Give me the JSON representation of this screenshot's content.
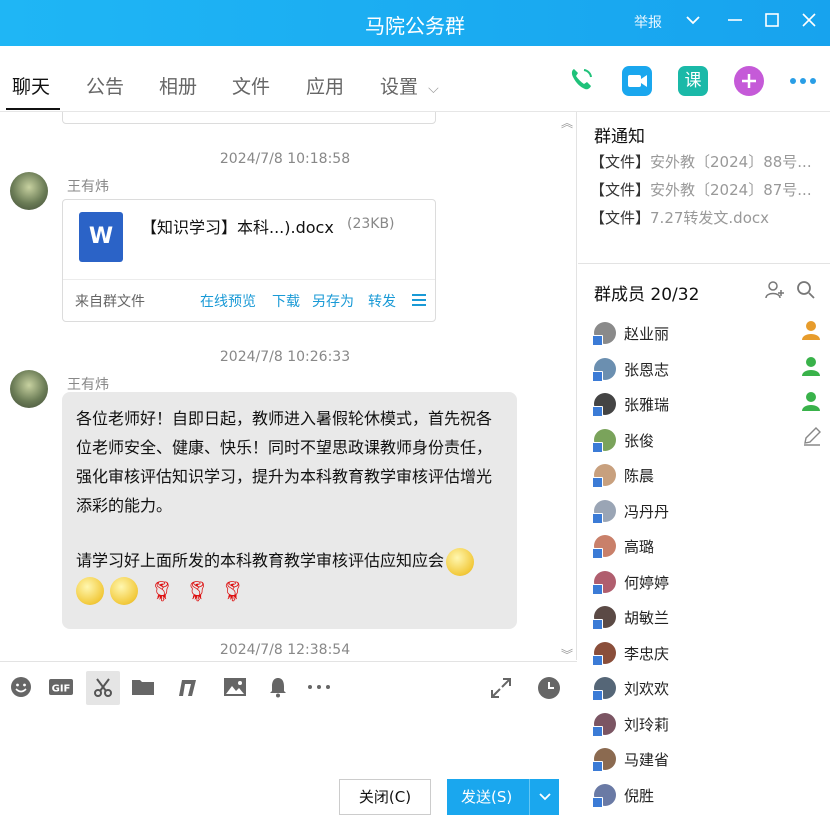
{
  "window": {
    "title": "马院公务群",
    "report": "举报"
  },
  "tabs": [
    {
      "label": "聊天"
    },
    {
      "label": "公告"
    },
    {
      "label": "相册"
    },
    {
      "label": "文件"
    },
    {
      "label": "应用"
    },
    {
      "label": "设置"
    }
  ],
  "settings_caret": "⌵",
  "toolbar_icons": {
    "class_label": "课"
  },
  "chat": {
    "msg1": {
      "time": "2024/7/8 10:18:58",
      "sender": "王有炜",
      "file": {
        "name": "【知识学习】本科...).docx",
        "size": "(23KB)",
        "from": "来自群文件",
        "preview": "在线预览",
        "download": "下载",
        "save_as": "另存为",
        "forward": "转发"
      }
    },
    "msg2": {
      "time": "2024/7/8 10:26:33",
      "sender": "王有炜",
      "para1": "各位老师好！自即日起，教师进入暑假轮休模式，首先祝各位老师安全、健康、快乐！同时不望思政课教师身份责任，强化审核评估知识学习，提升为本科教育教学审核评估增光添彩的能力。",
      "para2": "请学习好上面所发的本科教育教学审核评估应知应会"
    },
    "msg3": {
      "time": "2024/7/8 12:38:54"
    }
  },
  "input": {
    "close": "关闭(C)",
    "send": "发送(S)"
  },
  "notice": {
    "title": "群通知",
    "items": [
      {
        "tag": "【文件】",
        "name": "安外教〔2024〕88号..."
      },
      {
        "tag": "【文件】",
        "name": "安外教〔2024〕87号..."
      },
      {
        "tag": "【文件】",
        "name": "7.27转发文.docx"
      }
    ]
  },
  "members": {
    "title": "群成员 20/32",
    "list": [
      "赵业丽",
      "张恩志",
      "张雅瑞",
      "张俊",
      "陈晨",
      "冯丹丹",
      "高璐",
      "何婷婷",
      "胡敏兰",
      "李忠庆",
      "刘欢欢",
      "刘玲莉",
      "马建省",
      "倪胜"
    ]
  },
  "colors": {
    "accent": "#1aa7ee",
    "title_bar": "#1fb6f5",
    "link": "#1a9ad6"
  }
}
